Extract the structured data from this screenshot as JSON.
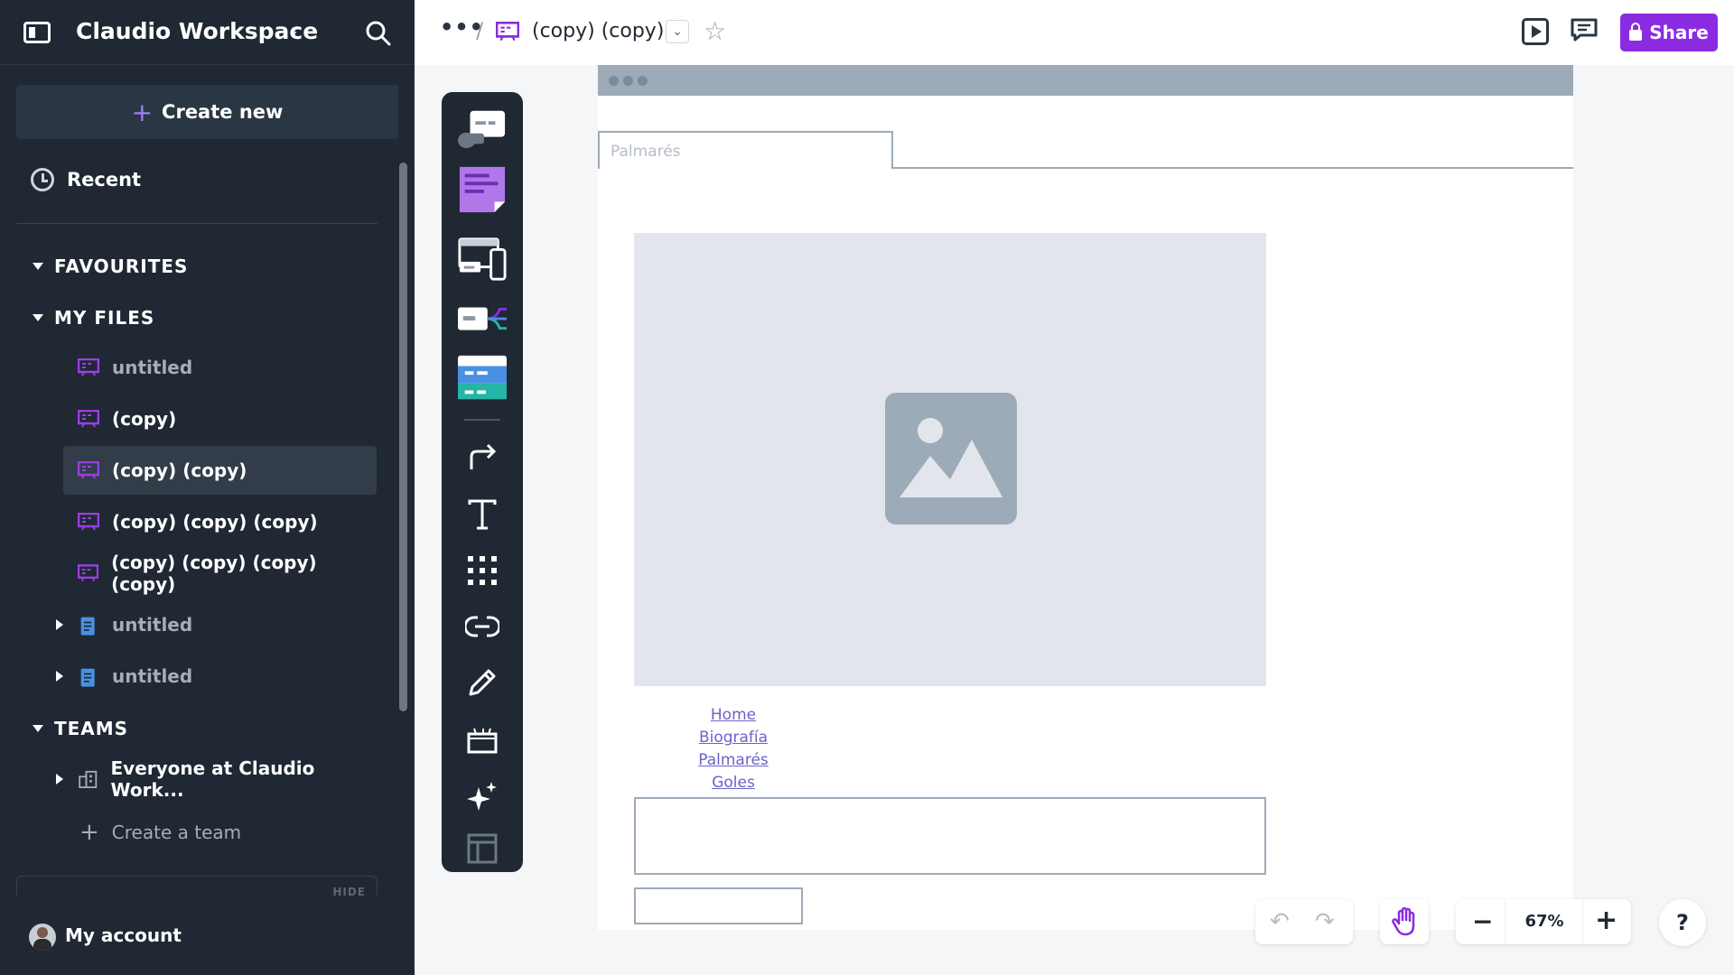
{
  "sidebar": {
    "workspace_title": "Claudio Workspace",
    "create_new_label": "Create new",
    "recent_label": "Recent",
    "favourites_label": "FAVOURITES",
    "my_files_label": "MY FILES",
    "files": [
      {
        "label": "untitled",
        "icon": "wireframe-icon"
      },
      {
        "label": "(copy)",
        "icon": "wireframe-icon"
      },
      {
        "label": "(copy) (copy)",
        "icon": "wireframe-icon",
        "selected": true
      },
      {
        "label": "(copy) (copy) (copy)",
        "icon": "wireframe-icon"
      },
      {
        "label": "(copy) (copy) (copy) (copy)",
        "icon": "wireframe-icon"
      },
      {
        "label": "untitled",
        "icon": "document-icon"
      },
      {
        "label": "untitled",
        "icon": "document-icon"
      }
    ],
    "teams_label": "TEAMS",
    "team_name": "Everyone at Claudio Work...",
    "create_team_label": "Create a team",
    "hide_label": "HIDE",
    "account_label": "My account"
  },
  "topbar": {
    "more_label": "•••",
    "separator": "/",
    "doc_title": "(copy) (copy)",
    "dropdown_label": "⌄",
    "favorite_glyph": "☆",
    "share_label": "Share"
  },
  "canvas": {
    "tab_label": "Palmarés",
    "nav_links": [
      "Home",
      "Biografía",
      "Palmarés",
      "Goles"
    ]
  },
  "controls": {
    "undo_glyph": "↶",
    "redo_glyph": "↷",
    "zoom_out": "−",
    "zoom_level": "67%",
    "zoom_in": "+",
    "help": "?"
  },
  "colors": {
    "sidebar_bg": "#1f2833",
    "accent_purple": "#8a2be2",
    "wireframe_gray": "#9dabb8",
    "link_purple": "#6b63c9"
  }
}
